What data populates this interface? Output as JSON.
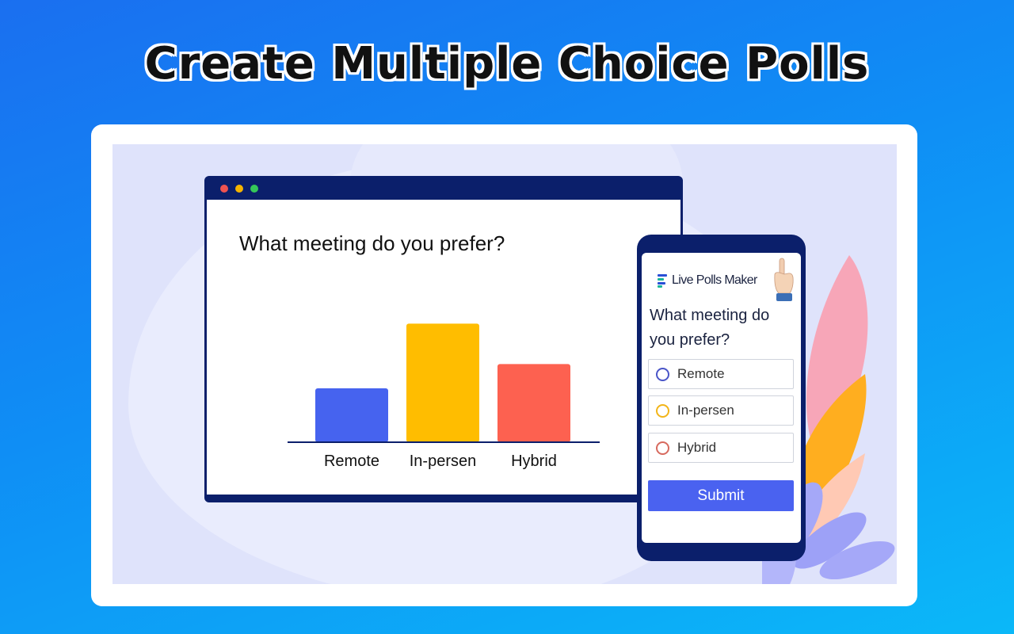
{
  "headline": "Create Multiple Choice Polls",
  "desktop": {
    "question": "What meeting do you prefer?"
  },
  "chart_data": {
    "type": "bar",
    "categories": [
      "Remote",
      "In-persen",
      "Hybrid"
    ],
    "values": [
      1.0,
      2.2,
      1.45
    ],
    "colors": [
      "#4663ef",
      "#ffbd00",
      "#fd6150"
    ],
    "title": "What meeting do you prefer?",
    "xlabel": "",
    "ylabel": "",
    "ylim": [
      0,
      2.5
    ],
    "grid": false
  },
  "phone": {
    "brand": "Live Polls Maker",
    "question": "What meeting do you prefer?",
    "options": [
      {
        "label": "Remote",
        "color": "#4a55c8"
      },
      {
        "label": "In-persen",
        "color": "#f2b519"
      },
      {
        "label": "Hybrid",
        "color": "#d76a5e"
      }
    ],
    "submit_label": "Submit"
  },
  "colors": {
    "window_frame": "#0b1f6b",
    "accent": "#4a62f0"
  }
}
